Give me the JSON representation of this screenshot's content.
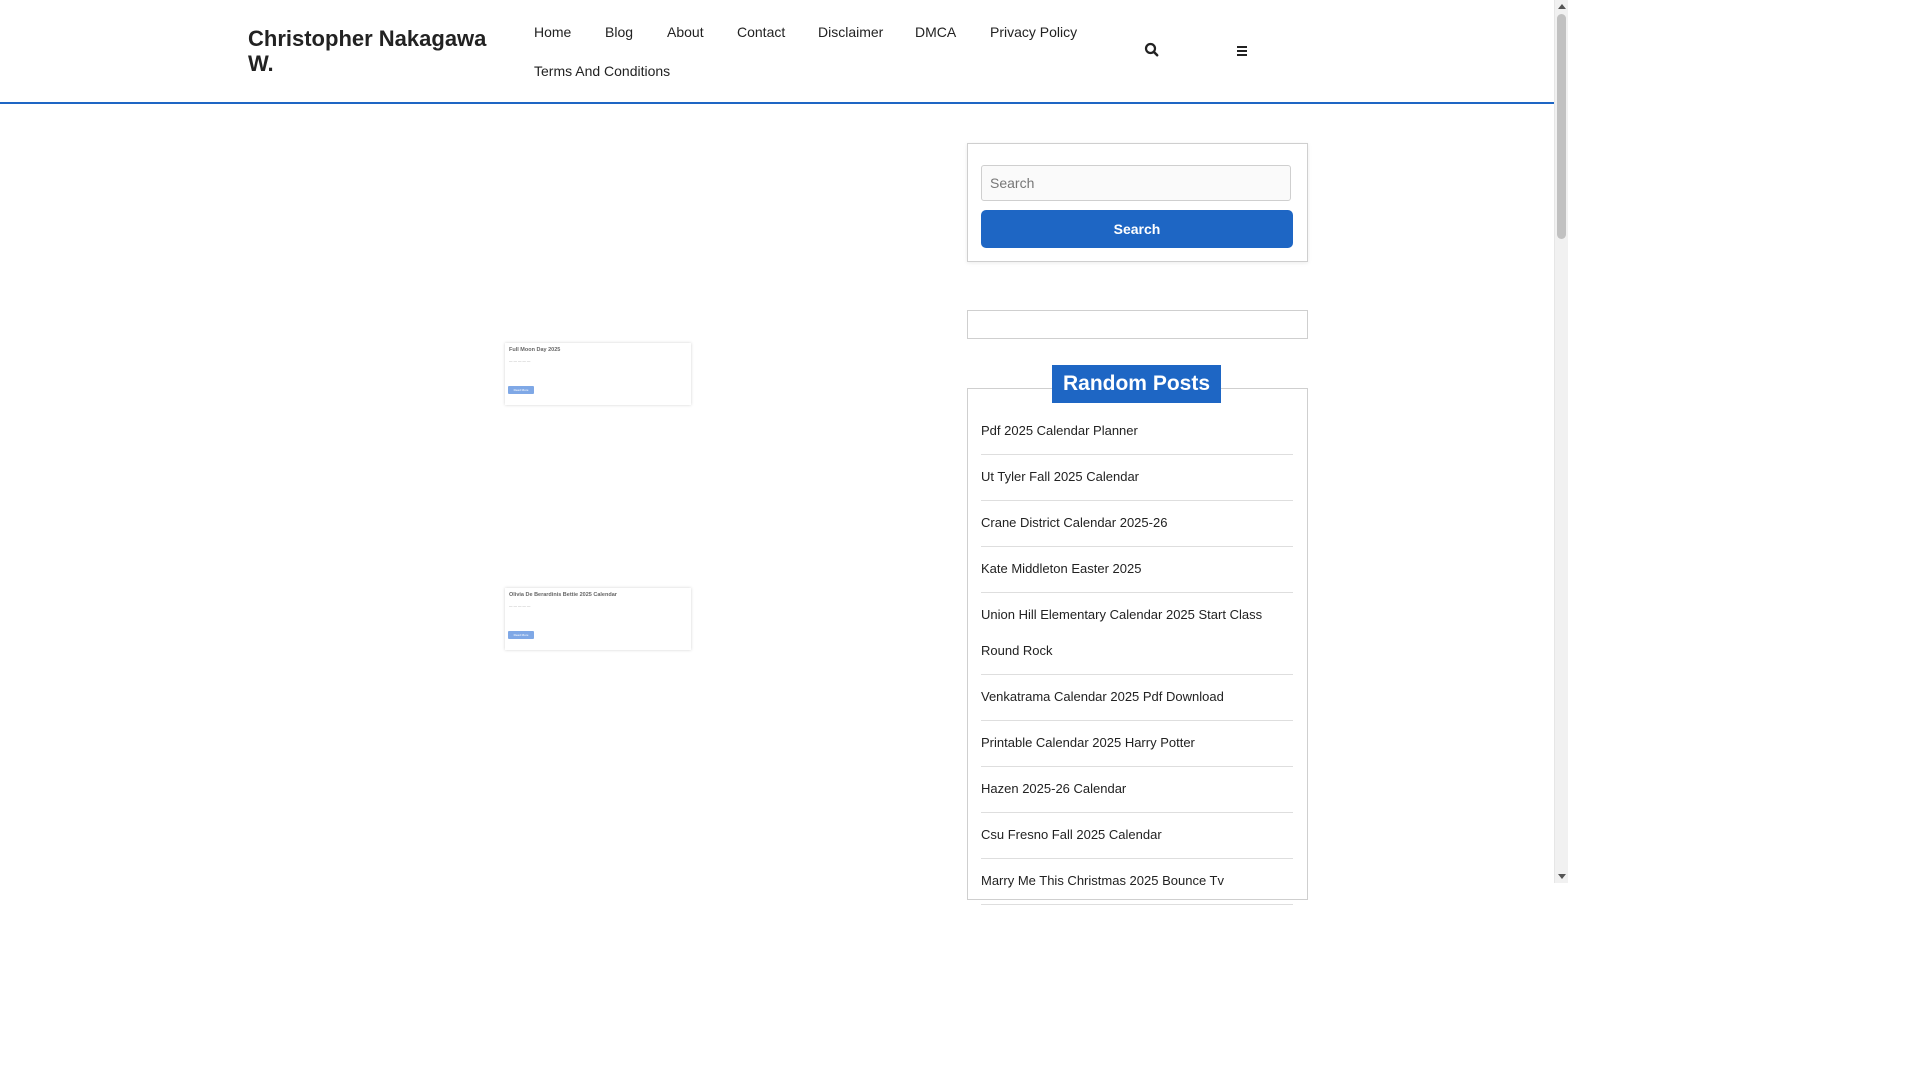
{
  "header": {
    "site_title": "Christopher Nakagawa W.",
    "nav": [
      "Home",
      "Blog",
      "About",
      "Contact",
      "Disclaimer",
      "DMCA",
      "Privacy Policy",
      "Terms And Conditions"
    ],
    "icons": [
      "search-icon",
      "menu-icon"
    ]
  },
  "cards": [
    {
      "title": "Full Moon Day 2025",
      "meta": "— — — — —",
      "excerpt": "",
      "button": "Read More"
    },
    {
      "title": "Olivia De Berardinis Bettie 2025 Calendar",
      "meta": "— — — — —",
      "excerpt": "",
      "button": "Read More"
    }
  ],
  "sidebar": {
    "search": {
      "placeholder": "Search",
      "button": "Search"
    },
    "random_posts": {
      "heading": "Random Posts",
      "items": [
        "Pdf 2025 Calendar Planner",
        "Ut Tyler Fall 2025 Calendar",
        "Crane District Calendar 2025-26",
        "Kate Middleton Easter 2025",
        "Union Hill Elementary Calendar 2025 Start Class Round Rock",
        "Venkatrama Calendar 2025 Pdf Download",
        "Printable Calendar 2025 Harry Potter",
        "Hazen 2025-26 Calendar",
        "Csu Fresno Fall 2025 Calendar",
        "Marry Me This Christmas 2025 Bounce Tv"
      ]
    }
  },
  "colors": {
    "accent": "#1e66c4",
    "text": "#222222",
    "border": "#cfcfcf"
  }
}
